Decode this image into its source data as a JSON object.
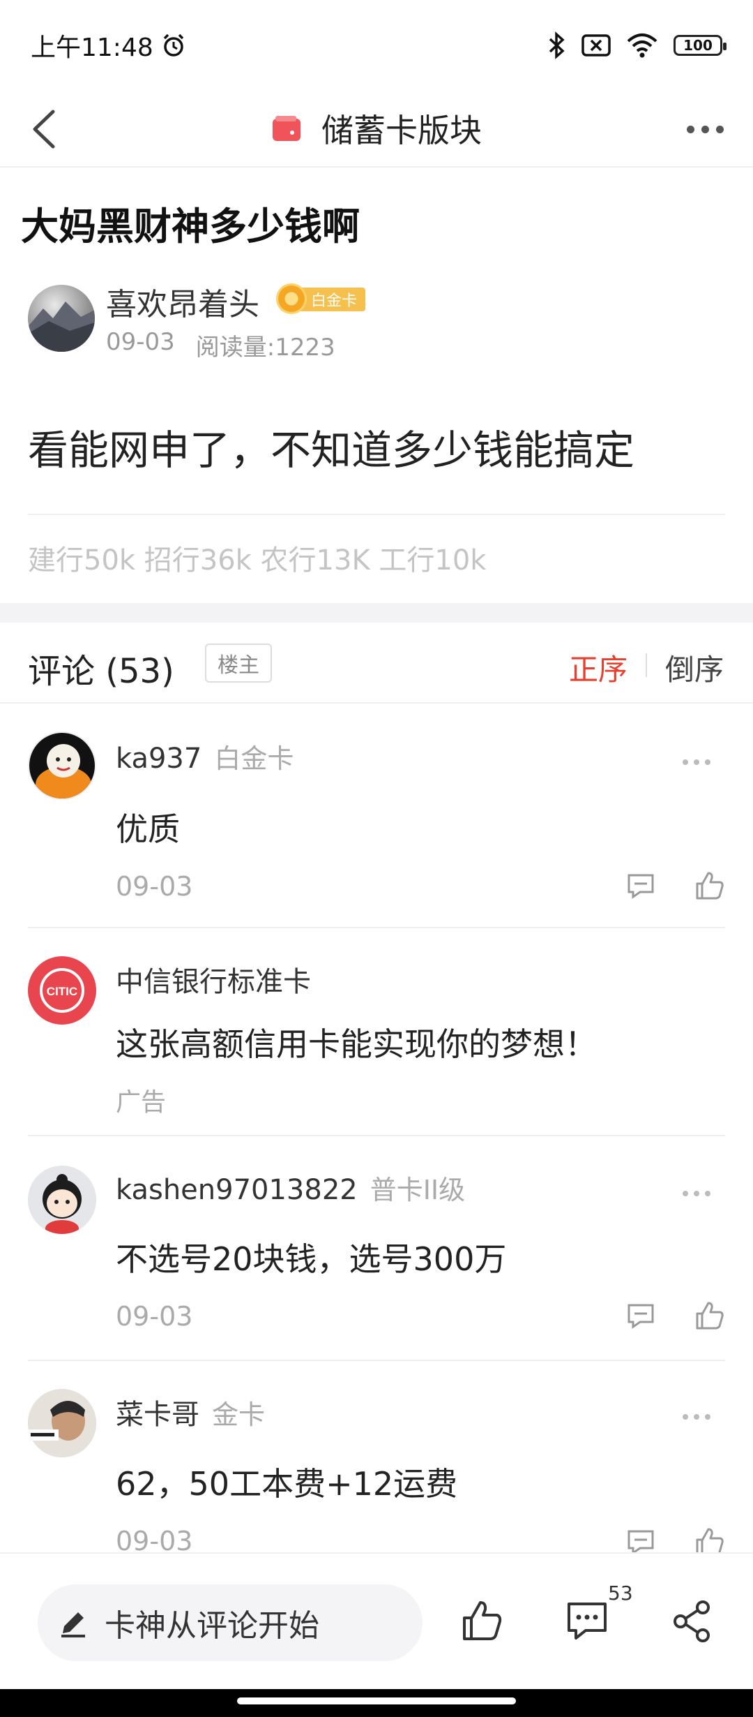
{
  "status_bar": {
    "time": "上午11:48",
    "battery": "100"
  },
  "nav": {
    "title": "储蓄卡版块"
  },
  "post": {
    "title": "大妈黑财神多少钱啊",
    "author": {
      "name": "喜欢昂着头",
      "badge": "白金卡",
      "date": "09-03",
      "views": "阅读量:1223"
    },
    "body": "看能网申了，不知道多少钱能搞定",
    "tags": "建行50k 招行36k 农行13K 工行10k"
  },
  "comments_header": {
    "title": "评论 (53)",
    "owner_filter": "楼主",
    "sort_asc": "正序",
    "sort_desc": "倒序"
  },
  "comments": [
    {
      "user": "ka937",
      "level": "白金卡",
      "text": "优质",
      "date": "09-03"
    },
    {
      "user": "中信银行标准卡",
      "text": "这张高额信用卡能实现你的梦想！",
      "ad_label": "广告",
      "ad_logo": "CITIC"
    },
    {
      "user": "kashen97013822",
      "level": "普卡II级",
      "text": "不选号20块钱，选号300万",
      "date": "09-03"
    },
    {
      "user": "菜卡哥",
      "level": "金卡",
      "text": "62，50工本费+12运费",
      "date": "09-03"
    }
  ],
  "bottom_bar": {
    "input_placeholder": "卡神从评论开始",
    "comment_count": "53"
  },
  "colors": {
    "accent": "#e6402c",
    "badge_gold": "#f5c04e",
    "ad_red": "#e8454f"
  }
}
